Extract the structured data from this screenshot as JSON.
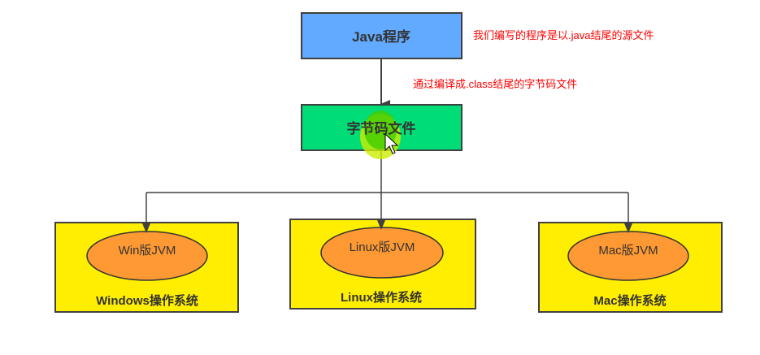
{
  "colors": {
    "java_box": "#62aaff",
    "bytecode_box": "#00dd77",
    "os_box": "#ffee00",
    "jvm_ellipse": "#ff9933",
    "annotation": "#ff0000",
    "line": "#404040"
  },
  "nodes": {
    "java_program": "Java程序",
    "bytecode_file": "字节码文件",
    "windows": {
      "jvm": "Win版JVM",
      "os": "Windows操作系统"
    },
    "linux": {
      "jvm": "Linux版JVM",
      "os": "Linux操作系统"
    },
    "mac": {
      "jvm": "Mac版JVM",
      "os": "Mac操作系统"
    }
  },
  "annotations": {
    "source": "我们编写的程序是以.java结尾的源文件",
    "compile": "通过编译成.class结尾的字节码文件"
  }
}
